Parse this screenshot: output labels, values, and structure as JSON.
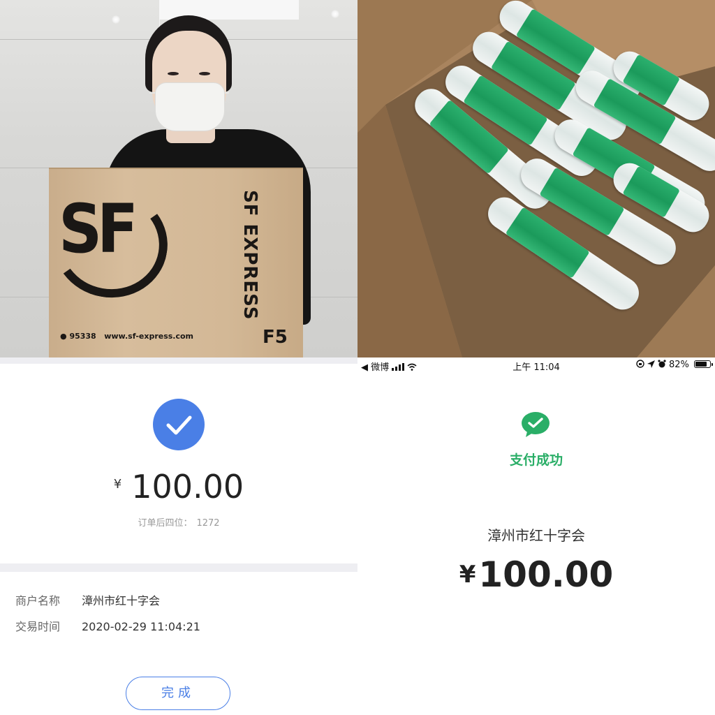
{
  "photo_box": {
    "logo": "SF",
    "brand_vertical": "SF EXPRESS",
    "phone": "95338",
    "site": "www.sf-express.com",
    "size_code": "F5"
  },
  "blue_payment": {
    "currency": "¥",
    "amount": "100.00",
    "order_label": "订单后四位：",
    "order_last4": "1272",
    "merchant_label": "商户名称",
    "merchant_value": "漳州市红十字会",
    "time_label": "交易时间",
    "time_value": "2020-02-29 11:04:21",
    "done_button": "完成",
    "accent": "#4a7fe6"
  },
  "wechat_payment": {
    "status_bar": {
      "back_app": "◀ 微博",
      "time": "上午 11:04",
      "battery": "82%",
      "battery_level": 0.82
    },
    "status": "支付成功",
    "merchant": "漳州市红十字会",
    "currency": "¥",
    "amount": "100.00",
    "accent": "#2aae67"
  }
}
